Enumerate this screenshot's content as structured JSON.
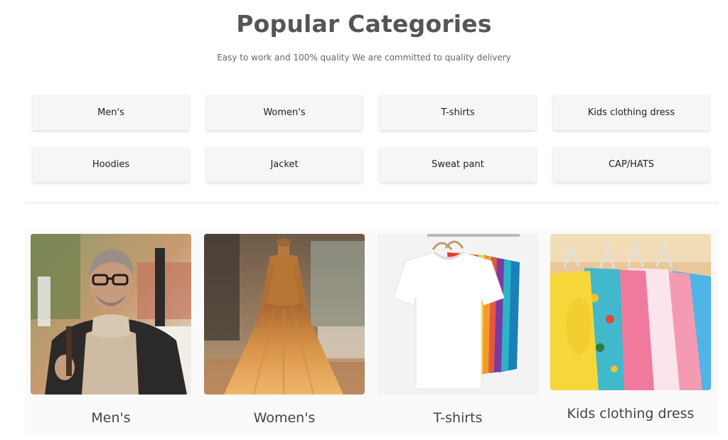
{
  "header": {
    "title": "Popular Categories",
    "subtitle": "Easy to work and 100% quality We are committed to quality delivery"
  },
  "categories": [
    {
      "label": "Men's"
    },
    {
      "label": "Women's"
    },
    {
      "label": "T-shirts"
    },
    {
      "label": "Kids clothing dress"
    },
    {
      "label": "Hoodies"
    },
    {
      "label": "Jacket"
    },
    {
      "label": "Sweat pant"
    },
    {
      "label": "CAP/HATS"
    }
  ],
  "cards": [
    {
      "label": "Men's",
      "image": "man-in-glasses-and-turtleneck"
    },
    {
      "label": "Women's",
      "image": "golden-sequin-gown"
    },
    {
      "label": "T-shirts",
      "image": "t-shirts-on-hangers"
    },
    {
      "label": "Kids clothing dress",
      "image": "kids-clothes-on-hangers"
    }
  ]
}
